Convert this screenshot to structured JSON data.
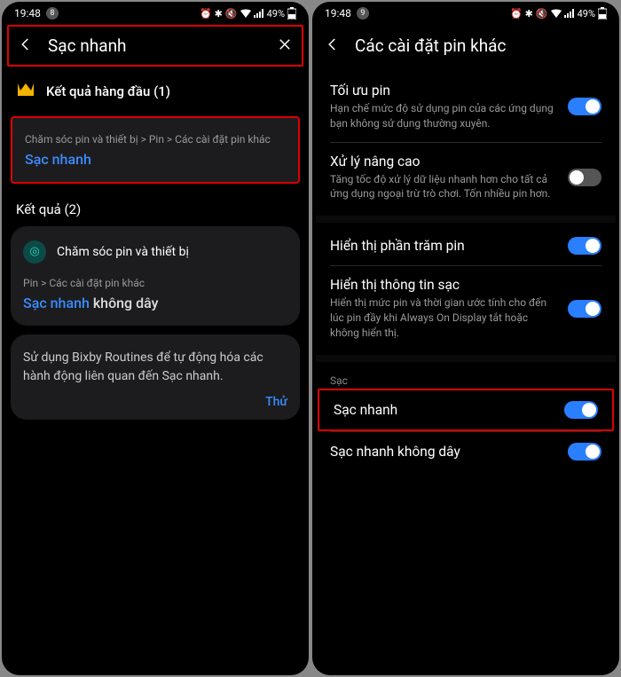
{
  "left": {
    "status": {
      "time": "19:48",
      "count": "8",
      "battery": "49%"
    },
    "header": {
      "title": "Sạc nhanh"
    },
    "top_section": "Kết quả hàng đầu (1)",
    "top_result": {
      "breadcrumb": "Chăm sóc pin và thiết bị > Pin > Các cài đặt pin khác",
      "label": "Sạc nhanh"
    },
    "results_label": "Kết quả (2)",
    "second_result": {
      "device": "Chăm sóc pin và thiết bị",
      "breadcrumb": "Pin > Các cài đặt pin khác",
      "link_blue": "Sạc nhanh",
      "link_rest": " không dây"
    },
    "bixby": {
      "text": "Sử dụng Bixby Routines để tự động hóa các hành động liên quan đến Sạc nhanh.",
      "try": "Thử"
    }
  },
  "right": {
    "status": {
      "time": "19:48",
      "count": "9",
      "battery": "49%"
    },
    "header": {
      "title": "Các cài đặt pin khác"
    },
    "items": {
      "opt": {
        "title": "Tối ưu pin",
        "sub": "Hạn chế mức độ sử dụng pin của các ứng dụng bạn không sử dụng thường xuyên."
      },
      "adv": {
        "title": "Xử lý nâng cao",
        "sub": "Tăng tốc độ xử lý dữ liệu nhanh hơn cho tất cả ứng dụng ngoại trừ trò chơi. Tốn nhiều pin hơn."
      },
      "pct": {
        "title": "Hiển thị phần trăm pin"
      },
      "chg": {
        "title": "Hiển thị thông tin sạc",
        "sub": "Hiển thị mức pin và thời gian ước tính cho đến lúc pin đầy khi Always On Display tắt hoặc không hiển thị."
      },
      "group": "Sạc",
      "fast": {
        "title": "Sạc nhanh"
      },
      "fastw": {
        "title": "Sạc nhanh không dây"
      }
    }
  }
}
